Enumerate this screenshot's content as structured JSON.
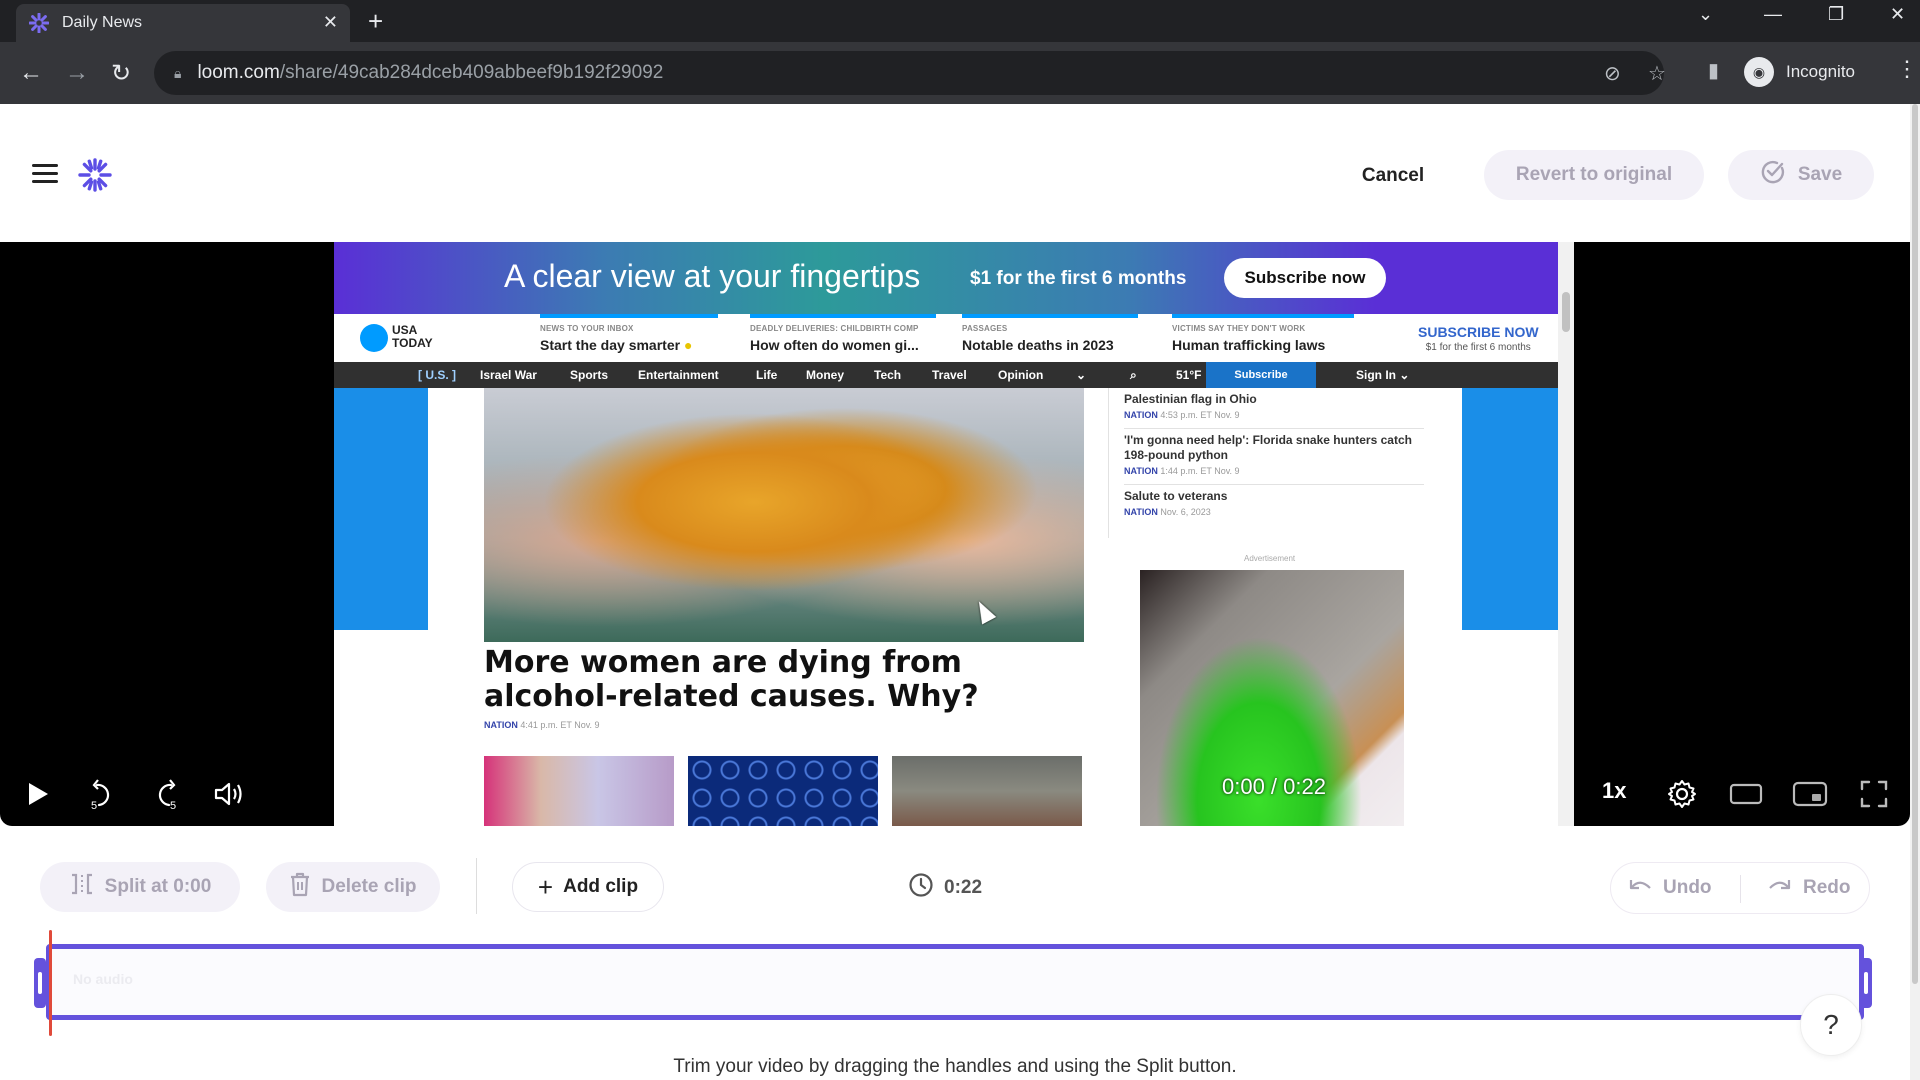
{
  "browser": {
    "tab_title": "Daily News",
    "url_host": "loom.com",
    "url_path": "/share/49cab284dceb409abbeef9b192f29092",
    "profile_label": "Incognito",
    "icons": {
      "back": "arrow-left-icon",
      "forward": "arrow-right-icon",
      "reload": "reload-icon",
      "lock": "lock-icon",
      "eye_off": "eye-off-icon",
      "star": "star-icon",
      "sidepanel": "side-panel-icon",
      "menu": "kebab-icon"
    }
  },
  "header": {
    "cancel_label": "Cancel",
    "revert_label": "Revert to original",
    "save_label": "Save",
    "brand_color": "#6452dc"
  },
  "video": {
    "page": {
      "promo_headline": "A clear view at your fingertips",
      "promo_offer": "$1 for the first 6 months",
      "promo_button": "Subscribe now",
      "logo_line1": "USA",
      "logo_line2": "TODAY",
      "masthead": [
        {
          "kicker": "NEWS TO YOUR INBOX",
          "title": "Start the day smarter"
        },
        {
          "kicker": "DEADLY DELIVERIES: CHILDBIRTH COMP",
          "title": "How often do women gi..."
        },
        {
          "kicker": "PASSAGES",
          "title": "Notable deaths in 2023"
        },
        {
          "kicker": "VICTIMS SAY THEY DON'T WORK",
          "title": "Human trafficking laws"
        }
      ],
      "subscribe_cta": "SUBSCRIBE NOW",
      "subscribe_sub": "$1 for the first 6 months",
      "nav": [
        "[ U.S. ]",
        "Israel War",
        "Sports",
        "Entertainment",
        "Life",
        "Money",
        "Tech",
        "Travel",
        "Opinion"
      ],
      "weather": "51°F",
      "nav_subscribe": "Subscribe",
      "nav_signin": "Sign In ⌄",
      "headline": "More women are dying from alcohol-related causes. Why?",
      "headline_section": "NATION",
      "headline_time": "4:41 p.m. ET Nov. 9",
      "side_stories": [
        {
          "title": "Palestinian flag in Ohio",
          "section": "NATION",
          "time": "4:53 p.m. ET Nov. 9"
        },
        {
          "title": "'I'm gonna need help': Florida snake hunters catch 198-pound python",
          "section": "NATION",
          "time": "1:44 p.m. ET Nov. 9"
        },
        {
          "title": "Salute to veterans",
          "section": "NATION",
          "time": "Nov. 6, 2023"
        }
      ],
      "ad_label": "Advertisement"
    },
    "time_overlay": "0:00 / 0:22",
    "speed": "1x",
    "current_time": "0:00",
    "duration": "0:22",
    "progress": 0.0
  },
  "editor": {
    "split_label": "Split at 0:00",
    "delete_label": "Delete clip",
    "add_label": "Add clip",
    "duration": "0:22",
    "undo_label": "Undo",
    "redo_label": "Redo",
    "timeline_label": "No audio",
    "trim_start": 0.0,
    "trim_end": 1.0,
    "playhead": 0.0,
    "help_label": "?",
    "hint": "Trim your video by dragging the handles and using the Split button."
  }
}
